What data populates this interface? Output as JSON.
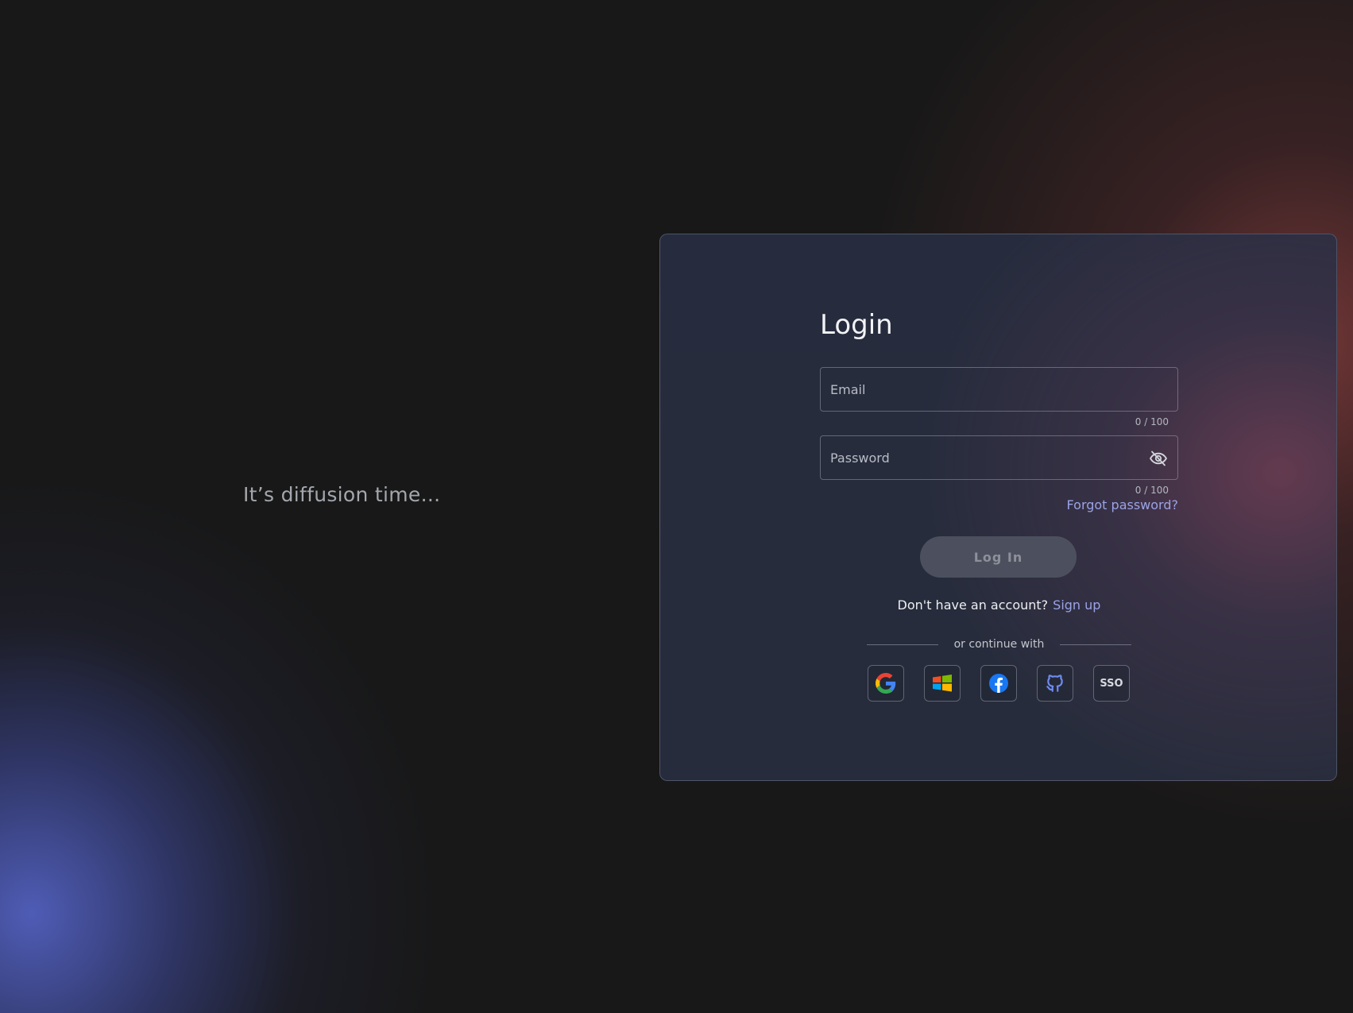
{
  "left_panel": {
    "tagline": "It’s diffusion time..."
  },
  "login": {
    "title": "Login",
    "email": {
      "value": "",
      "placeholder": "Email",
      "counter": "0 / 100"
    },
    "password": {
      "value": "",
      "placeholder": "Password",
      "counter": "0 / 100",
      "toggle_icon": "eye-off-icon"
    },
    "forgot_password": "Forgot password?",
    "submit_label": "Log In",
    "signup_prompt": "Don't have an account?",
    "signup_link": "Sign up",
    "divider_text": "or continue with",
    "providers": [
      {
        "name": "google",
        "icon": "google-icon"
      },
      {
        "name": "microsoft",
        "icon": "microsoft-icon"
      },
      {
        "name": "facebook",
        "icon": "facebook-icon"
      },
      {
        "name": "github",
        "icon": "github-icon"
      },
      {
        "name": "sso",
        "label": "SSO"
      }
    ]
  },
  "colors": {
    "background": "#181818",
    "card": "#262c3b",
    "accent_link": "#9aa3e6",
    "button_disabled": "#4c505e"
  }
}
